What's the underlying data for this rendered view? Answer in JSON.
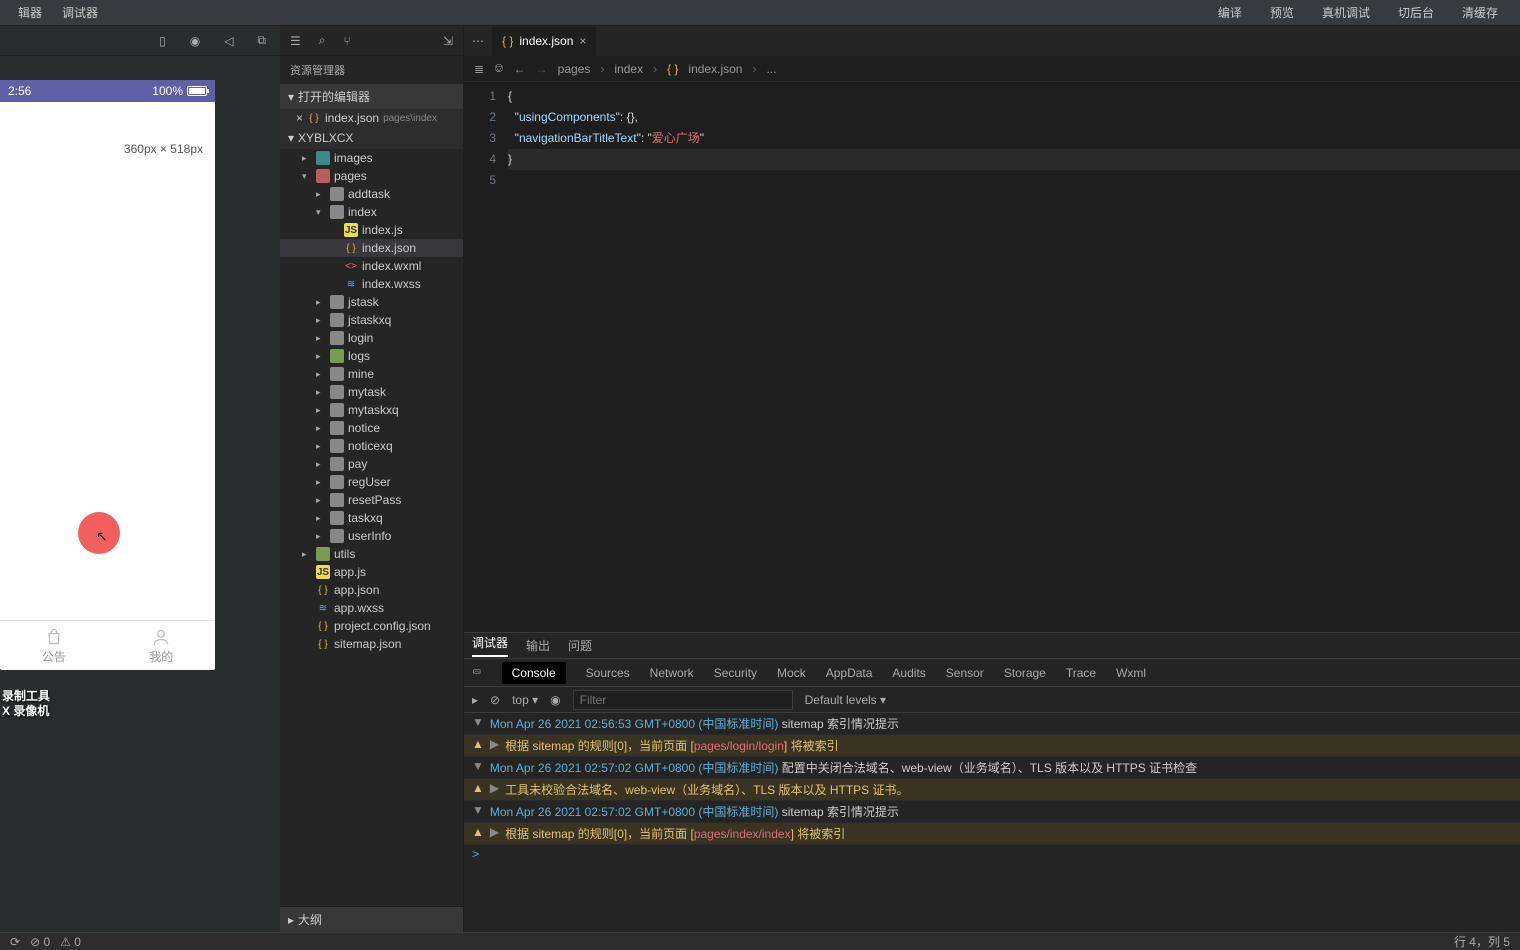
{
  "topMenu": {
    "left": [
      "辑器",
      "调试器"
    ],
    "right": [
      "编译",
      "预览",
      "真机调试",
      "切后台",
      "清缓存"
    ]
  },
  "simToolbar": {
    "icons": [
      "phone",
      "record",
      "back",
      "split"
    ]
  },
  "phone": {
    "time": "2:56",
    "battery": "100%",
    "dim": "360px × 518px",
    "tabs": [
      "公告",
      "我的"
    ],
    "watermark1": "录制工具",
    "watermark2": "X 录像机"
  },
  "explorer": {
    "title": "资源管理器",
    "openEditorsLabel": "打开的编辑器",
    "openFile": {
      "name": "index.json",
      "path": "pages\\index"
    },
    "projectName": "XYBLXCX",
    "folders": [
      {
        "name": "images",
        "depth": 1,
        "open": false,
        "color": "teal"
      },
      {
        "name": "pages",
        "depth": 1,
        "open": true,
        "color": "red"
      },
      {
        "name": "addtask",
        "depth": 2,
        "open": false,
        "color": "grey"
      },
      {
        "name": "index",
        "depth": 2,
        "open": true,
        "color": "grey"
      },
      {
        "file": "index.js",
        "depth": 3,
        "icon": "js"
      },
      {
        "file": "index.json",
        "depth": 3,
        "icon": "json",
        "selected": true
      },
      {
        "file": "index.wxml",
        "depth": 3,
        "icon": "wxml"
      },
      {
        "file": "index.wxss",
        "depth": 3,
        "icon": "wxss"
      },
      {
        "name": "jstask",
        "depth": 2,
        "open": false,
        "color": "grey"
      },
      {
        "name": "jstaskxq",
        "depth": 2,
        "open": false,
        "color": "grey"
      },
      {
        "name": "login",
        "depth": 2,
        "open": false,
        "color": "grey"
      },
      {
        "name": "logs",
        "depth": 2,
        "open": false,
        "color": "green"
      },
      {
        "name": "mine",
        "depth": 2,
        "open": false,
        "color": "grey"
      },
      {
        "name": "mytask",
        "depth": 2,
        "open": false,
        "color": "grey"
      },
      {
        "name": "mytaskxq",
        "depth": 2,
        "open": false,
        "color": "grey"
      },
      {
        "name": "notice",
        "depth": 2,
        "open": false,
        "color": "grey"
      },
      {
        "name": "noticexq",
        "depth": 2,
        "open": false,
        "color": "grey"
      },
      {
        "name": "pay",
        "depth": 2,
        "open": false,
        "color": "grey"
      },
      {
        "name": "regUser",
        "depth": 2,
        "open": false,
        "color": "grey"
      },
      {
        "name": "resetPass",
        "depth": 2,
        "open": false,
        "color": "grey"
      },
      {
        "name": "taskxq",
        "depth": 2,
        "open": false,
        "color": "grey"
      },
      {
        "name": "userInfo",
        "depth": 2,
        "open": false,
        "color": "grey"
      },
      {
        "name": "utils",
        "depth": 1,
        "open": false,
        "color": "green"
      },
      {
        "file": "app.js",
        "depth": 1,
        "icon": "js"
      },
      {
        "file": "app.json",
        "depth": 1,
        "icon": "json"
      },
      {
        "file": "app.wxss",
        "depth": 1,
        "icon": "wxss"
      },
      {
        "file": "project.config.json",
        "depth": 1,
        "icon": "json"
      },
      {
        "file": "sitemap.json",
        "depth": 1,
        "icon": "json"
      }
    ],
    "outlineLabel": "大纲"
  },
  "editor": {
    "tab": "index.json",
    "breadcrumb": [
      "pages",
      "index",
      "index.json",
      "..."
    ],
    "lines": [
      "1",
      "2",
      "3",
      "4",
      "5"
    ],
    "code": {
      "usingComponents": "usingComponents",
      "navKey": "navigationBarTitleText",
      "navVal": "爱心广场"
    }
  },
  "devtools": {
    "tabs1": [
      "调试器",
      "输出",
      "问题"
    ],
    "tabs2": [
      "Console",
      "Sources",
      "Network",
      "Security",
      "Mock",
      "AppData",
      "Audits",
      "Sensor",
      "Storage",
      "Trace",
      "Wxml"
    ],
    "filter": {
      "top": "top",
      "placeholder": "Filter",
      "levels": "Default levels"
    },
    "logs": [
      {
        "type": "log",
        "tri": true,
        "text": "Mon Apr 26 2021 02:56:53 GMT+0800 (中国标准时间) sitemap 索引情况提示",
        "ts": true
      },
      {
        "type": "warn",
        "tri": false,
        "text": "根据 sitemap 的规则[0]，当前页面 [pages/login/login] 将被索引"
      },
      {
        "type": "log",
        "tri": true,
        "text": "Mon Apr 26 2021 02:57:02 GMT+0800 (中国标准时间) 配置中关闭合法域名、web-view（业务域名）、TLS 版本以及 HTTPS 证书检查",
        "ts": true
      },
      {
        "type": "warn",
        "tri": false,
        "text": "工具未校验合法域名、web-view（业务域名）、TLS 版本以及 HTTPS 证书。"
      },
      {
        "type": "log",
        "tri": true,
        "text": "Mon Apr 26 2021 02:57:02 GMT+0800 (中国标准时间) sitemap 索引情况提示",
        "ts": true
      },
      {
        "type": "warn",
        "tri": false,
        "text": "根据 sitemap 的规则[0]，当前页面 [pages/index/index] 将被索引"
      }
    ]
  },
  "statusBar": {
    "errors": "0",
    "warnings": "0",
    "pos": "行 4，列 5"
  }
}
